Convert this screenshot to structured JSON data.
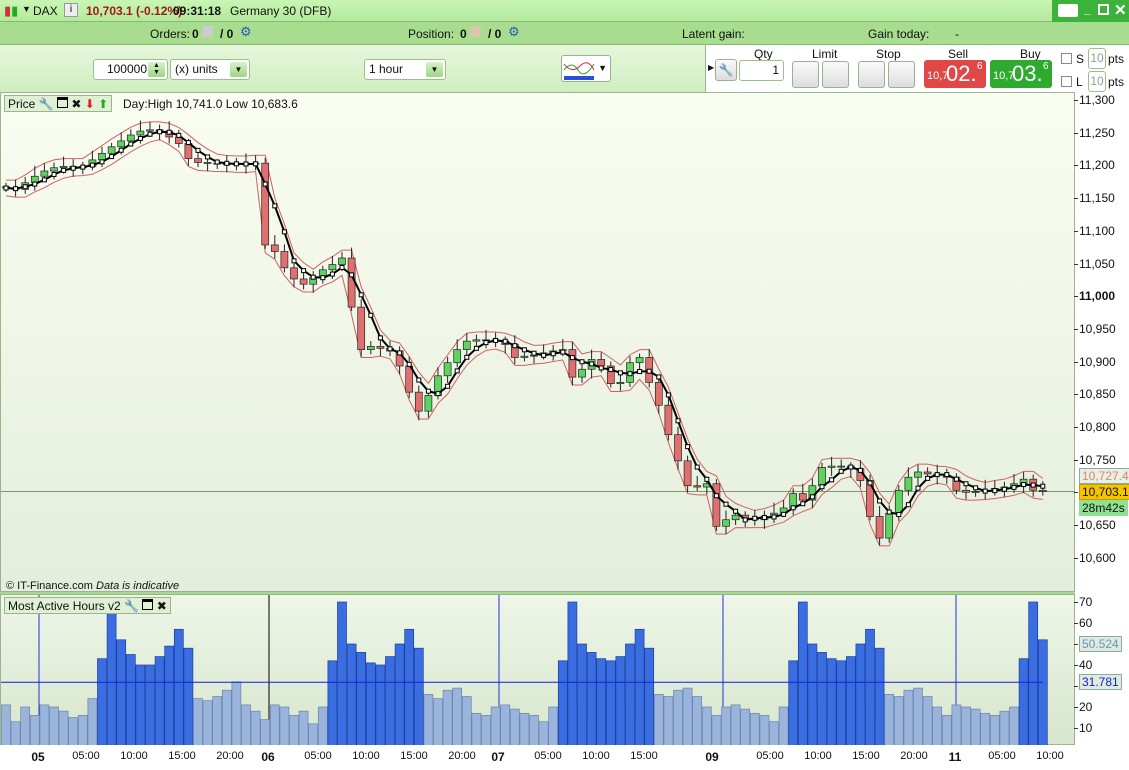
{
  "titlebar": {
    "symbol": "DAX",
    "price_change": "10,703.1 (-0.12%)",
    "time": "09:31:18",
    "instrument": "Germany 30 (DFB)"
  },
  "status": {
    "orders_label": "Orders:",
    "orders_count": "0",
    "orders_sep": "/ 0",
    "position_label": "Position:",
    "position_count": "0",
    "position_sep": "/ 0",
    "latent_label": "Latent gain:",
    "latent_value": "-",
    "gain_today_label": "Gain today:",
    "gain_today_value": "-"
  },
  "toolbar": {
    "amount": "100000",
    "units": "(x) units",
    "timeframe": "1 hour"
  },
  "order_ticket": {
    "qty_label": "Qty",
    "qty_value": "1",
    "limit_label": "Limit",
    "stop_label": "Stop",
    "sell_label": "Sell",
    "sell_small": "10,7",
    "sell_big": "02.",
    "sell_sup": "6",
    "buy_label": "Buy",
    "buy_small": "10,7",
    "buy_big": "03.",
    "buy_sup": "6",
    "s_label": "S",
    "s_value": "10",
    "l_label": "L",
    "l_value": "10",
    "pts": "pts",
    "sell_color": "#e04848",
    "buy_color": "#2eaa2e"
  },
  "price_panel": {
    "title": "Price",
    "day_range": "Day:High 10,741.0 Low 10,683.6",
    "copyright": "© IT-Finance.com",
    "disclaimer": "Data is indicative",
    "axis_ticks": [
      "11,300",
      "11,250",
      "11,200",
      "11,150",
      "11,100",
      "11,050",
      "11,000",
      "10,950",
      "10,900",
      "10,850",
      "10,800",
      "10,750",
      "10,700",
      "10,650",
      "10,600"
    ],
    "tag_upper": "10,727.4",
    "tag_last": "10,703.1",
    "tag_timer": "28m42s"
  },
  "volume_panel": {
    "title": "Most Active Hours v2",
    "axis_ticks": [
      "70",
      "60",
      "50",
      "40",
      "30",
      "20",
      "10"
    ],
    "tag_avg": "50.524",
    "tag_line": "31.781"
  },
  "x_axis": [
    {
      "t": "05",
      "bold": true
    },
    {
      "t": "05:00"
    },
    {
      "t": "10:00"
    },
    {
      "t": "15:00"
    },
    {
      "t": "20:00"
    },
    {
      "t": "06",
      "bold": true
    },
    {
      "t": "05:00"
    },
    {
      "t": "10:00"
    },
    {
      "t": "15:00"
    },
    {
      "t": "20:00"
    },
    {
      "t": "07",
      "bold": true
    },
    {
      "t": "05:00"
    },
    {
      "t": "10:00"
    },
    {
      "t": "15:00"
    },
    {
      "t": "09",
      "bold": true
    },
    {
      "t": "05:00"
    },
    {
      "t": "10:00"
    },
    {
      "t": "15:00"
    },
    {
      "t": "20:00"
    },
    {
      "t": "11",
      "bold": true
    },
    {
      "t": "05:00"
    },
    {
      "t": "10:00"
    }
  ],
  "chart_data": {
    "type": "candlestick",
    "ylim": [
      10600,
      11300
    ],
    "volume_ylim": [
      0,
      70
    ],
    "volume_hline": 31.781,
    "closes": [
      11167,
      11165,
      11175,
      11185,
      11193,
      11198,
      11200,
      11198,
      11200,
      11210,
      11220,
      11230,
      11239,
      11248,
      11254,
      11256,
      11254,
      11245,
      11235,
      11212,
      11206,
      11205,
      11204,
      11204,
      11203,
      11204,
      11205,
      11080,
      11070,
      11045,
      11028,
      11020,
      11030,
      11042,
      11050,
      11060,
      10985,
      10920,
      10925,
      10922,
      10918,
      10895,
      10855,
      10826,
      10850,
      10880,
      10900,
      10920,
      10933,
      10935,
      10935,
      10933,
      10928,
      10908,
      10910,
      10912,
      10915,
      10918,
      10920,
      10878,
      10890,
      10905,
      10895,
      10868,
      10870,
      10900,
      10908,
      10870,
      10835,
      10790,
      10750,
      10712,
      10710,
      10715,
      10650,
      10660,
      10667,
      10662,
      10660,
      10665,
      10670,
      10678,
      10700,
      10690,
      10712,
      10740,
      10742,
      10742,
      10738,
      10720,
      10665,
      10632,
      10670,
      10705,
      10725,
      10733,
      10730,
      10728,
      10725,
      10705,
      10702,
      10703,
      10705,
      10708,
      10710,
      10715,
      10722,
      10705,
      10703
    ],
    "volumes": [
      21,
      13,
      20,
      16,
      21,
      20,
      18,
      15,
      16,
      24,
      43,
      70,
      52,
      45,
      40,
      40,
      44,
      49,
      57,
      48,
      24,
      23,
      25,
      28,
      32,
      21,
      18,
      14,
      21,
      20,
      16,
      18,
      12,
      20,
      42,
      70,
      50,
      46,
      41,
      40,
      44,
      50,
      57,
      48,
      26,
      24,
      28,
      29,
      25,
      17,
      16,
      20,
      21,
      19,
      17,
      16,
      13,
      20,
      42,
      70,
      50,
      46,
      43,
      42,
      44,
      50,
      57,
      48,
      26,
      25,
      28,
      29,
      25,
      20,
      16,
      20,
      21,
      19,
      17,
      16,
      13,
      20,
      42,
      70,
      50,
      46,
      43,
      42,
      44,
      50,
      57,
      48,
      26,
      25,
      28,
      29,
      25,
      20,
      16,
      21,
      20,
      19,
      17,
      16,
      18,
      20,
      43,
      70,
      52
    ]
  }
}
